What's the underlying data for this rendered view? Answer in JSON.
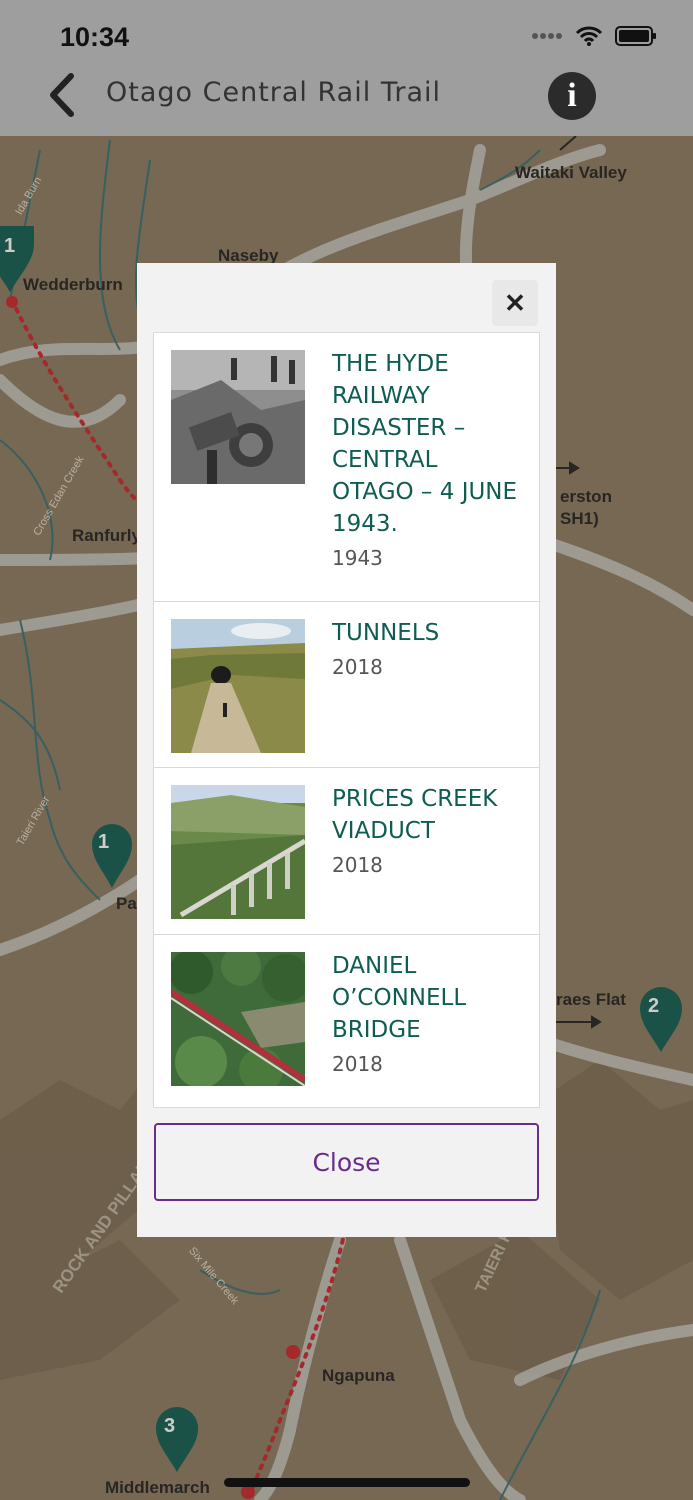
{
  "status_bar": {
    "time": "10:34"
  },
  "nav": {
    "title": "Otago Central Rail Trail",
    "info_label": "i"
  },
  "map": {
    "labels": [
      "Waitaki Valley",
      "Naseby",
      "Wedderburn",
      "Ranfurly",
      "erston",
      "SH1)",
      "Pate",
      "raes Flat",
      "Ngapuna",
      "Middlemarch",
      "Rock and Pillar"
    ],
    "small_labels": [
      "Ida Burn",
      "Cross Edan Creek",
      "Taieri River",
      "Six Mile Creek",
      "ROCK AND PILLAR R",
      "TAIERI RIDGE"
    ],
    "markers": [
      "1",
      "1",
      "2",
      "3"
    ]
  },
  "modal": {
    "close_x": "✕",
    "items": [
      {
        "title": "THE HYDE RAILWAY DISASTER – CENTRAL OTAGO – 4 JUNE 1943.",
        "year": "1943",
        "image": "railway-disaster-photo"
      },
      {
        "title": "TUNNELS",
        "year": "2018",
        "image": "tunnel-photo"
      },
      {
        "title": "PRICES CREEK VIADUCT",
        "year": "2018",
        "image": "viaduct-photo"
      },
      {
        "title": "DANIEL O’CONNELL BRIDGE",
        "year": "2018",
        "image": "bridge-photo"
      }
    ],
    "close_label": "Close"
  },
  "colors": {
    "accent_green": "#0f5c52",
    "button_purple": "#6a2c8a",
    "map_bg": "#8a7a62"
  }
}
